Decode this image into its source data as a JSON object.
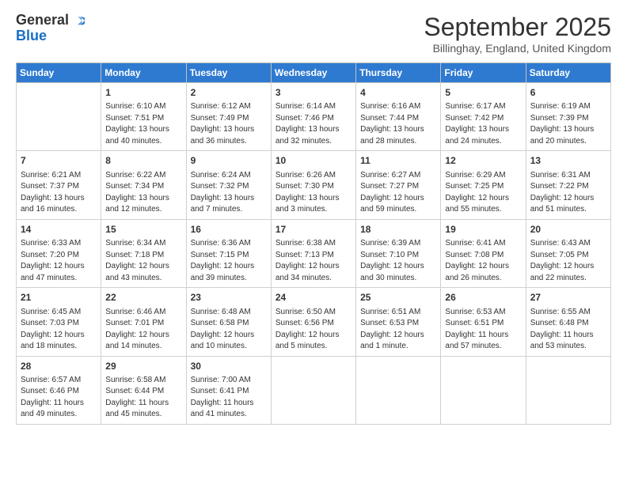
{
  "logo": {
    "general": "General",
    "blue": "Blue"
  },
  "title": "September 2025",
  "location": "Billinghay, England, United Kingdom",
  "days_of_week": [
    "Sunday",
    "Monday",
    "Tuesday",
    "Wednesday",
    "Thursday",
    "Friday",
    "Saturday"
  ],
  "weeks": [
    [
      {
        "day": "",
        "content": ""
      },
      {
        "day": "1",
        "content": "Sunrise: 6:10 AM\nSunset: 7:51 PM\nDaylight: 13 hours\nand 40 minutes."
      },
      {
        "day": "2",
        "content": "Sunrise: 6:12 AM\nSunset: 7:49 PM\nDaylight: 13 hours\nand 36 minutes."
      },
      {
        "day": "3",
        "content": "Sunrise: 6:14 AM\nSunset: 7:46 PM\nDaylight: 13 hours\nand 32 minutes."
      },
      {
        "day": "4",
        "content": "Sunrise: 6:16 AM\nSunset: 7:44 PM\nDaylight: 13 hours\nand 28 minutes."
      },
      {
        "day": "5",
        "content": "Sunrise: 6:17 AM\nSunset: 7:42 PM\nDaylight: 13 hours\nand 24 minutes."
      },
      {
        "day": "6",
        "content": "Sunrise: 6:19 AM\nSunset: 7:39 PM\nDaylight: 13 hours\nand 20 minutes."
      }
    ],
    [
      {
        "day": "7",
        "content": "Sunrise: 6:21 AM\nSunset: 7:37 PM\nDaylight: 13 hours\nand 16 minutes."
      },
      {
        "day": "8",
        "content": "Sunrise: 6:22 AM\nSunset: 7:34 PM\nDaylight: 13 hours\nand 12 minutes."
      },
      {
        "day": "9",
        "content": "Sunrise: 6:24 AM\nSunset: 7:32 PM\nDaylight: 13 hours\nand 7 minutes."
      },
      {
        "day": "10",
        "content": "Sunrise: 6:26 AM\nSunset: 7:30 PM\nDaylight: 13 hours\nand 3 minutes."
      },
      {
        "day": "11",
        "content": "Sunrise: 6:27 AM\nSunset: 7:27 PM\nDaylight: 12 hours\nand 59 minutes."
      },
      {
        "day": "12",
        "content": "Sunrise: 6:29 AM\nSunset: 7:25 PM\nDaylight: 12 hours\nand 55 minutes."
      },
      {
        "day": "13",
        "content": "Sunrise: 6:31 AM\nSunset: 7:22 PM\nDaylight: 12 hours\nand 51 minutes."
      }
    ],
    [
      {
        "day": "14",
        "content": "Sunrise: 6:33 AM\nSunset: 7:20 PM\nDaylight: 12 hours\nand 47 minutes."
      },
      {
        "day": "15",
        "content": "Sunrise: 6:34 AM\nSunset: 7:18 PM\nDaylight: 12 hours\nand 43 minutes."
      },
      {
        "day": "16",
        "content": "Sunrise: 6:36 AM\nSunset: 7:15 PM\nDaylight: 12 hours\nand 39 minutes."
      },
      {
        "day": "17",
        "content": "Sunrise: 6:38 AM\nSunset: 7:13 PM\nDaylight: 12 hours\nand 34 minutes."
      },
      {
        "day": "18",
        "content": "Sunrise: 6:39 AM\nSunset: 7:10 PM\nDaylight: 12 hours\nand 30 minutes."
      },
      {
        "day": "19",
        "content": "Sunrise: 6:41 AM\nSunset: 7:08 PM\nDaylight: 12 hours\nand 26 minutes."
      },
      {
        "day": "20",
        "content": "Sunrise: 6:43 AM\nSunset: 7:05 PM\nDaylight: 12 hours\nand 22 minutes."
      }
    ],
    [
      {
        "day": "21",
        "content": "Sunrise: 6:45 AM\nSunset: 7:03 PM\nDaylight: 12 hours\nand 18 minutes."
      },
      {
        "day": "22",
        "content": "Sunrise: 6:46 AM\nSunset: 7:01 PM\nDaylight: 12 hours\nand 14 minutes."
      },
      {
        "day": "23",
        "content": "Sunrise: 6:48 AM\nSunset: 6:58 PM\nDaylight: 12 hours\nand 10 minutes."
      },
      {
        "day": "24",
        "content": "Sunrise: 6:50 AM\nSunset: 6:56 PM\nDaylight: 12 hours\nand 5 minutes."
      },
      {
        "day": "25",
        "content": "Sunrise: 6:51 AM\nSunset: 6:53 PM\nDaylight: 12 hours\nand 1 minute."
      },
      {
        "day": "26",
        "content": "Sunrise: 6:53 AM\nSunset: 6:51 PM\nDaylight: 11 hours\nand 57 minutes."
      },
      {
        "day": "27",
        "content": "Sunrise: 6:55 AM\nSunset: 6:48 PM\nDaylight: 11 hours\nand 53 minutes."
      }
    ],
    [
      {
        "day": "28",
        "content": "Sunrise: 6:57 AM\nSunset: 6:46 PM\nDaylight: 11 hours\nand 49 minutes."
      },
      {
        "day": "29",
        "content": "Sunrise: 6:58 AM\nSunset: 6:44 PM\nDaylight: 11 hours\nand 45 minutes."
      },
      {
        "day": "30",
        "content": "Sunrise: 7:00 AM\nSunset: 6:41 PM\nDaylight: 11 hours\nand 41 minutes."
      },
      {
        "day": "",
        "content": ""
      },
      {
        "day": "",
        "content": ""
      },
      {
        "day": "",
        "content": ""
      },
      {
        "day": "",
        "content": ""
      }
    ]
  ]
}
